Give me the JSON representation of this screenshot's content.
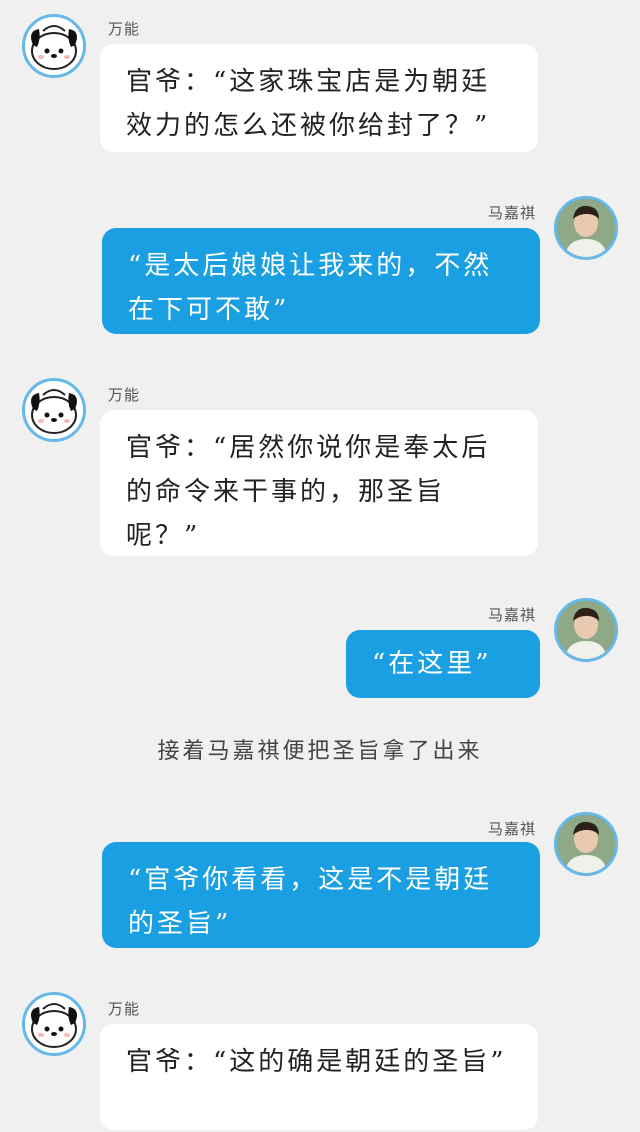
{
  "messages": [
    {
      "side": "left",
      "sender": "万能",
      "text": "官爷：“这家珠宝店是为朝廷效力的怎么还被你给封了？”",
      "avatar": "dog-avatar"
    },
    {
      "side": "right",
      "sender": "马嘉祺",
      "text": "“是太后娘娘让我来的，不然在下可不敢”",
      "avatar": "boy-avatar"
    },
    {
      "side": "left",
      "sender": "万能",
      "text": "官爷：“居然你说你是奉太后的命令来干事的，那圣旨呢？”",
      "avatar": "dog-avatar"
    },
    {
      "side": "right",
      "sender": "马嘉祺",
      "text": "“在这里”",
      "avatar": "boy-avatar"
    },
    {
      "side": "right",
      "sender": "马嘉祺",
      "text": "“官爷你看看，这是不是朝廷的圣旨”",
      "avatar": "boy-avatar"
    },
    {
      "side": "left",
      "sender": "万能",
      "text": "官爷：“这的确是朝廷的圣旨”",
      "avatar": "dog-avatar"
    }
  ],
  "narration": "接着马嘉祺便把圣旨拿了出来",
  "colors": {
    "background": "#f0f0f0",
    "right_bubble": "#1a9fe2",
    "left_bubble": "#ffffff",
    "avatar_ring": "#66b8e8"
  }
}
